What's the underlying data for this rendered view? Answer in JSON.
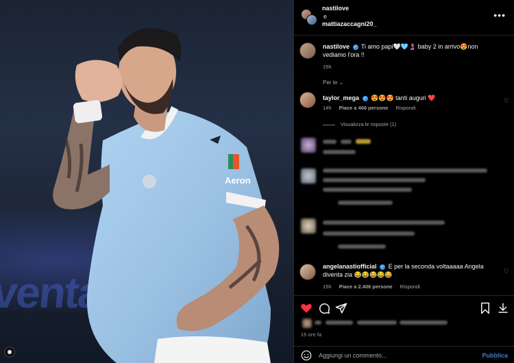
{
  "post": {
    "authors": [
      "nastilove",
      "mattiazaccagni20_"
    ],
    "connector": "e"
  },
  "caption": {
    "username": "nastilove",
    "text": "Ti amo papi🤍🩵🤰 baby 2 in arrivo😍non vediamo l'ora !!",
    "time": "15h",
    "translate_label": "Per te"
  },
  "comments": [
    {
      "username": "taylor_mega",
      "text": "😍😍😍 tanti auguri ❤️",
      "time": "14h",
      "likes": "Piace a 466 persone",
      "reply_label": "Rispondi",
      "view_replies": "Visualizza le risposte (1)"
    },
    {
      "username": "angelanastiofficial",
      "text": "E per la seconda voltaaaaa Angela diventa zia 😂😂😂😂😂",
      "time": "15h",
      "likes": "Piace a 2.406 persone",
      "reply_label": "Rispondi"
    }
  ],
  "footer": {
    "time_ago": "15 ore fa",
    "comment_placeholder": "Aggiungi un commento...",
    "publish_label": "Pubblica"
  },
  "colors": {
    "like_red": "#ff3040",
    "link_blue": "#3d7fc0",
    "verified_blue": "#3897f0",
    "jersey_blue": "#9ec9ee"
  },
  "icons": [
    "more-icon",
    "heart-icon",
    "comment-icon",
    "share-icon",
    "bookmark-icon",
    "download-icon",
    "emoji-icon"
  ]
}
